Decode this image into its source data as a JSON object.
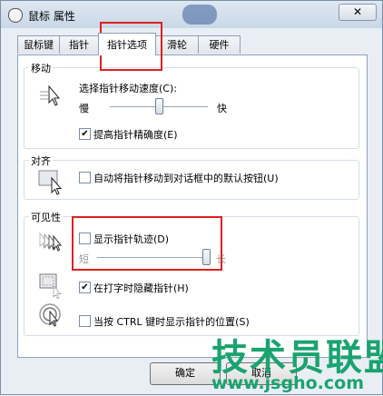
{
  "window": {
    "title": "鼠标 属性",
    "close_symbol": "✕"
  },
  "tabs": [
    {
      "label": "鼠标键",
      "active": false
    },
    {
      "label": "指针",
      "active": false
    },
    {
      "label": "指针选项",
      "active": true
    },
    {
      "label": "滑轮",
      "active": false
    },
    {
      "label": "硬件",
      "active": false
    }
  ],
  "motion": {
    "title": "移动",
    "speed_label": "选择指针移动速度(C):",
    "slow": "慢",
    "fast": "快",
    "speed_level": 0.5,
    "precision_label": "提高指针精确度(E)",
    "precision_checked": true
  },
  "snap": {
    "title": "对齐",
    "snap_label": "自动将指针移动到对话框中的默认按钮(U)",
    "snap_checked": false
  },
  "visibility": {
    "title": "可见性",
    "trails_label": "显示指针轨迹(D)",
    "trails_checked": false,
    "short": "短",
    "long": "长",
    "trails_level": 1.0,
    "hide_label": "在打字时隐藏指针(H)",
    "hide_checked": true,
    "ctrl_label": "当按 CTRL 键时显示指针的位置(S)",
    "ctrl_checked": false
  },
  "footer": {
    "ok": "确定",
    "cancel": "取消"
  },
  "watermark": {
    "title": "技术员联盟",
    "url": "www.jsgho.com"
  },
  "colors": {
    "highlight": "#e02020",
    "watermark": "#1aa36f"
  }
}
